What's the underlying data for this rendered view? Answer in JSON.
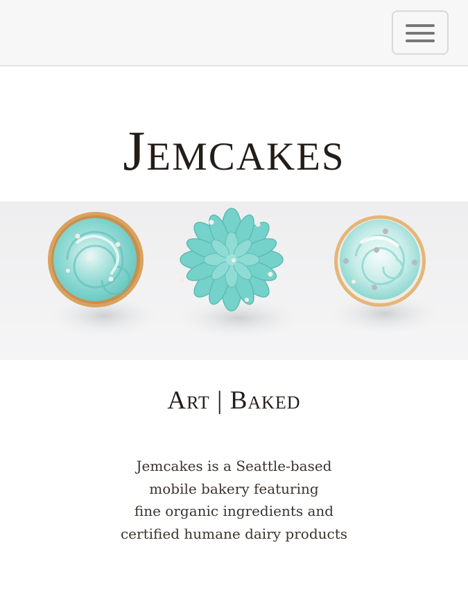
{
  "header": {
    "menu_icon": "hamburger-menu-icon"
  },
  "brand": {
    "title": "Jemcakes"
  },
  "hero": {
    "image_icon": "cupcakes-photo"
  },
  "tagline": "Art | Baked",
  "description": {
    "lines": [
      "Jemcakes is a Seattle-based",
      "mobile bakery featuring",
      "fine organic ingredients and",
      "certified humane dairy products"
    ]
  },
  "colors": {
    "navbar_bg": "#f7f7f7",
    "text_dark": "#241c17",
    "frosting": "#7fd6cf",
    "cake": "#d9a35f"
  }
}
